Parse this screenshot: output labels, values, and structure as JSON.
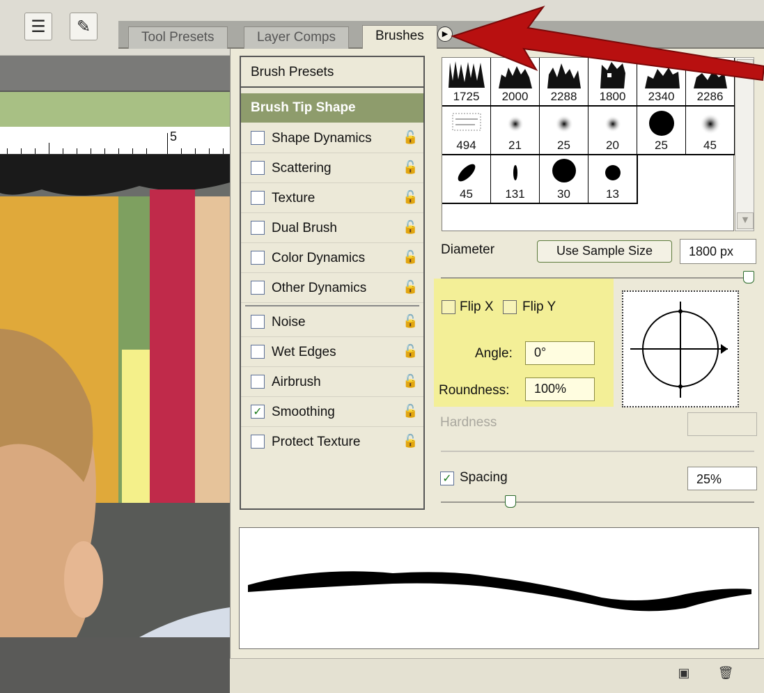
{
  "tabs": [
    {
      "label": "Tool Presets"
    },
    {
      "label": "Layer Comps"
    },
    {
      "label": "Brushes"
    }
  ],
  "ruler": {
    "number": "5"
  },
  "brush_list": {
    "presets_label": "Brush Presets",
    "tip_shape_label": "Brush Tip Shape",
    "options": [
      {
        "label": "Shape Dynamics",
        "checked": false
      },
      {
        "label": "Scattering",
        "checked": false
      },
      {
        "label": "Texture",
        "checked": false
      },
      {
        "label": "Dual Brush",
        "checked": false
      },
      {
        "label": "Color Dynamics",
        "checked": false
      },
      {
        "label": "Other Dynamics",
        "checked": false
      },
      {
        "label": "Noise",
        "checked": false
      },
      {
        "label": "Wet Edges",
        "checked": false
      },
      {
        "label": "Airbrush",
        "checked": false
      },
      {
        "label": "Smoothing",
        "checked": true
      },
      {
        "label": "Protect Texture",
        "checked": false
      }
    ]
  },
  "brush_grid": {
    "rows": [
      [
        "1725",
        "2000",
        "2288",
        "1800",
        "2340",
        "2286"
      ],
      [
        "494",
        "21",
        "25",
        "20",
        "25",
        "45"
      ],
      [
        "45",
        "131",
        "30",
        "13"
      ]
    ]
  },
  "diameter": {
    "label": "Diameter",
    "button": "Use Sample Size",
    "value": "1800 px",
    "slider_fraction": 1.0
  },
  "flip": {
    "x_label": "Flip X",
    "y_label": "Flip Y"
  },
  "angle": {
    "label": "Angle:",
    "value": "0°"
  },
  "roundness": {
    "label": "Roundness:",
    "value": "100%"
  },
  "hardness": {
    "label": "Hardness",
    "value": ""
  },
  "spacing": {
    "label": "Spacing",
    "value": "25%",
    "checked": true,
    "slider_fraction": 0.12
  },
  "colors": {
    "accent_header": "#8e9c6c",
    "highlight": "#f5f08c",
    "arrow": "#b81010"
  }
}
